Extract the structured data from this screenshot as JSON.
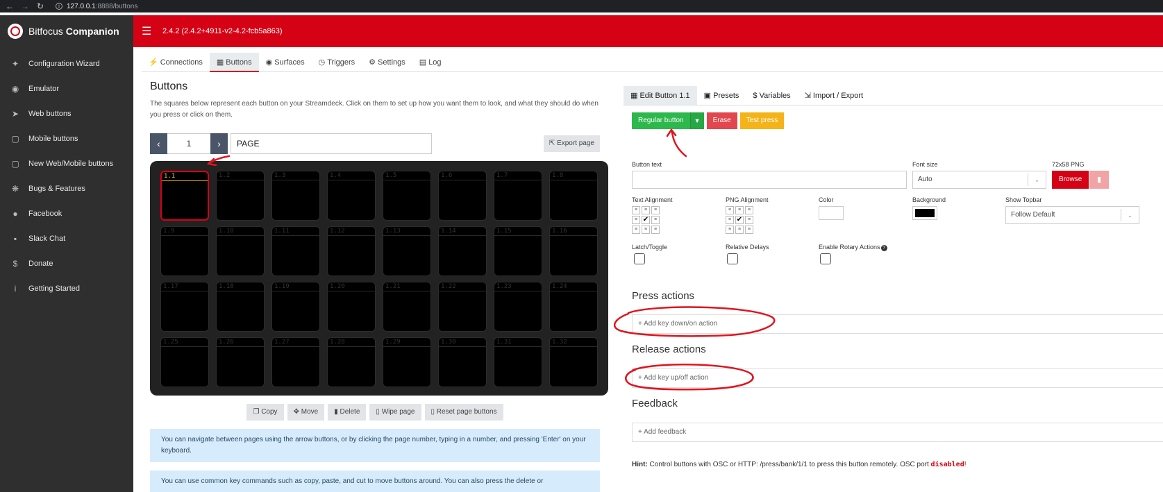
{
  "browser": {
    "back_icon": "arrow-left-icon",
    "forward_icon": "arrow-right-icon",
    "reload_icon": "reload-icon",
    "url_host": "127.0.0.1",
    "url_rest": ":8888/buttons"
  },
  "brand": {
    "name_plain": "Bitfocus",
    "name_bold": "Companion"
  },
  "sidebar": {
    "items": [
      {
        "label": "Configuration Wizard",
        "icon": "magic-wand-icon"
      },
      {
        "label": "Emulator",
        "icon": "gamepad-icon"
      },
      {
        "label": "Web buttons",
        "icon": "pointer-icon"
      },
      {
        "label": "Mobile buttons",
        "icon": "tablet-icon"
      },
      {
        "label": "New Web/Mobile buttons",
        "icon": "tablet-icon"
      },
      {
        "label": "Bugs & Features",
        "icon": "bug-icon"
      },
      {
        "label": "Facebook",
        "icon": "users-icon"
      },
      {
        "label": "Slack Chat",
        "icon": "comments-icon"
      },
      {
        "label": "Donate",
        "icon": "dollar-icon"
      },
      {
        "label": "Getting Started",
        "icon": "info-icon"
      }
    ]
  },
  "header": {
    "version": "2.4.2 (2.4.2+4911-v2-4.2-fcb5a863)"
  },
  "tabs": [
    {
      "label": "Connections",
      "icon": "plug-icon"
    },
    {
      "label": "Buttons",
      "icon": "calendar-icon"
    },
    {
      "label": "Surfaces",
      "icon": "gamepad-icon"
    },
    {
      "label": "Triggers",
      "icon": "clock-icon"
    },
    {
      "label": "Settings",
      "icon": "user-cog-icon"
    },
    {
      "label": "Log",
      "icon": "clipboard-icon"
    }
  ],
  "buttons_panel": {
    "title": "Buttons",
    "description": "The squares below represent each button on your Streamdeck. Click on them to set up how you want them to look, and what they should do when you press or click on them.",
    "page_number": "1",
    "page_name": "PAGE",
    "export_label": "Export page",
    "cells": [
      "1.1",
      "1.2",
      "1.3",
      "1.4",
      "1.5",
      "1.6",
      "1.7",
      "1.8",
      "1.9",
      "1.10",
      "1.11",
      "1.12",
      "1.13",
      "1.14",
      "1.15",
      "1.16",
      "1.17",
      "1.18",
      "1.19",
      "1.20",
      "1.21",
      "1.22",
      "1.23",
      "1.24",
      "1.25",
      "1.26",
      "1.27",
      "1.28",
      "1.29",
      "1.30",
      "1.31",
      "1.32"
    ],
    "selected_cell": "1.1",
    "actions": {
      "copy": "Copy",
      "move": "Move",
      "delete": "Delete",
      "wipe": "Wipe page",
      "reset": "Reset page buttons"
    },
    "info1": "You can navigate between pages using the arrow buttons, or by clicking the page number, typing in a number, and pressing 'Enter' on your keyboard.",
    "info2": "You can use common key commands such as copy, paste, and cut to move buttons around. You can also press the delete or"
  },
  "edit_panel": {
    "tabs": {
      "edit": "Edit Button 1.1",
      "presets": "Presets",
      "variables": "Variables",
      "import_export": "Import / Export"
    },
    "type_button": "Regular button",
    "erase": "Erase",
    "test_press": "Test press",
    "button_text_label": "Button text",
    "font_size_label": "Font size",
    "font_size_value": "Auto",
    "png_label": "72x58 PNG",
    "browse": "Browse",
    "text_alignment_label": "Text Alignment",
    "png_alignment_label": "PNG Alignment",
    "color_label": "Color",
    "background_label": "Background",
    "show_topbar_label": "Show Topbar",
    "show_topbar_value": "Follow Default",
    "latch_label": "Latch/Toggle",
    "relative_delays_label": "Relative Delays",
    "rotary_label": "Enable Rotary Actions",
    "press_actions_title": "Press actions",
    "press_add": "+ Add key down/on action",
    "release_actions_title": "Release actions",
    "release_add": "+ Add key up/off action",
    "feedback_title": "Feedback",
    "feedback_add": "+ Add feedback",
    "hint_label": "Hint:",
    "hint_text": " Control buttons with OSC or HTTP: /press/bank/1/1 to press this button remotely. OSC port ",
    "hint_code": "disabled",
    "hint_end": "!"
  },
  "colors": {
    "brand_red": "#d50215",
    "sidebar_bg": "#2f2f2f",
    "text_color_swatch": "#ffffff",
    "background_swatch": "#000000"
  }
}
